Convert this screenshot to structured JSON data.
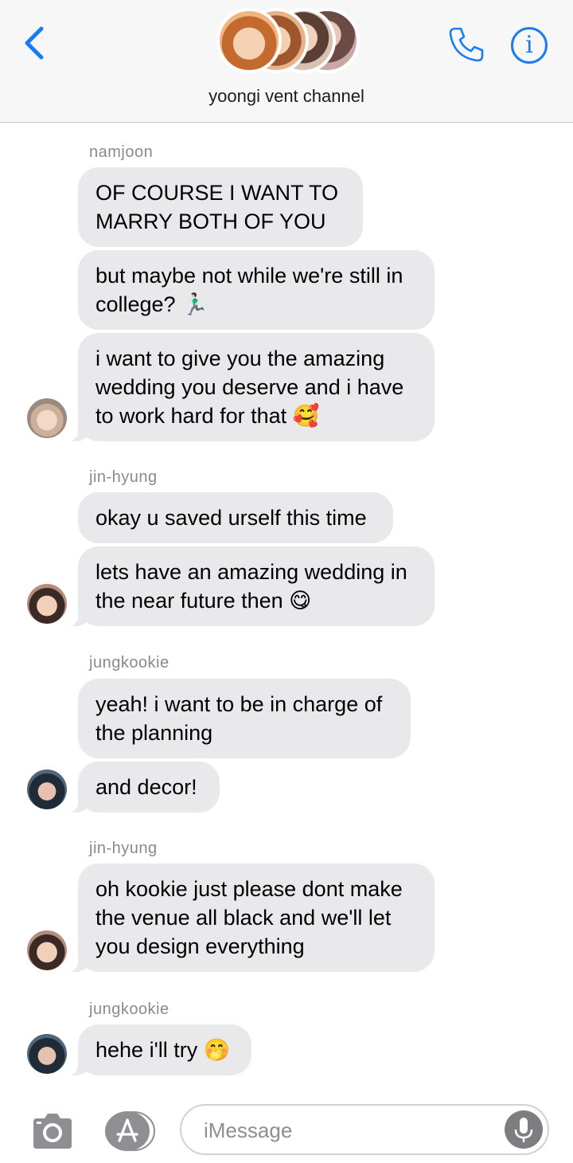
{
  "header": {
    "title": "yoongi vent channel",
    "back_icon": "chevron-left-icon",
    "call_icon": "phone-icon",
    "info_label": "i",
    "accent_color": "#1a7cf5"
  },
  "messages": [
    {
      "sender": "namjoon",
      "avatar_icon": "namjoon-avatar",
      "bubbles": [
        "OF COURSE I WANT TO MARRY BOTH OF YOU",
        "but maybe not while we're still in college? 🏃🏻‍♂️",
        "i want to give you the amazing wedding you deserve and i have to work hard for that 🥰"
      ]
    },
    {
      "sender": "jin-hyung",
      "avatar_icon": "jin-avatar",
      "bubbles": [
        "okay u saved urself this time",
        "lets have an amazing wedding in the near future then 😋"
      ]
    },
    {
      "sender": "jungkookie",
      "avatar_icon": "jungkook-avatar",
      "bubbles": [
        "yeah! i want to be in charge of the planning",
        "and decor!"
      ]
    },
    {
      "sender": "jin-hyung",
      "avatar_icon": "jin-avatar",
      "bubbles": [
        "oh kookie just please dont make the venue all black and we'll let you design everything"
      ]
    },
    {
      "sender": "jungkookie",
      "avatar_icon": "jungkook-avatar",
      "bubbles": [
        "hehe i'll try 🤭"
      ]
    }
  ],
  "composer": {
    "placeholder": "iMessage",
    "camera_icon": "camera-icon",
    "apps_icon": "app-store-icon",
    "mic_icon": "microphone-icon"
  },
  "colors": {
    "bubble": "#e9e9eb",
    "sender_name": "#8a8a8e",
    "placeholder": "#8e8e93"
  }
}
